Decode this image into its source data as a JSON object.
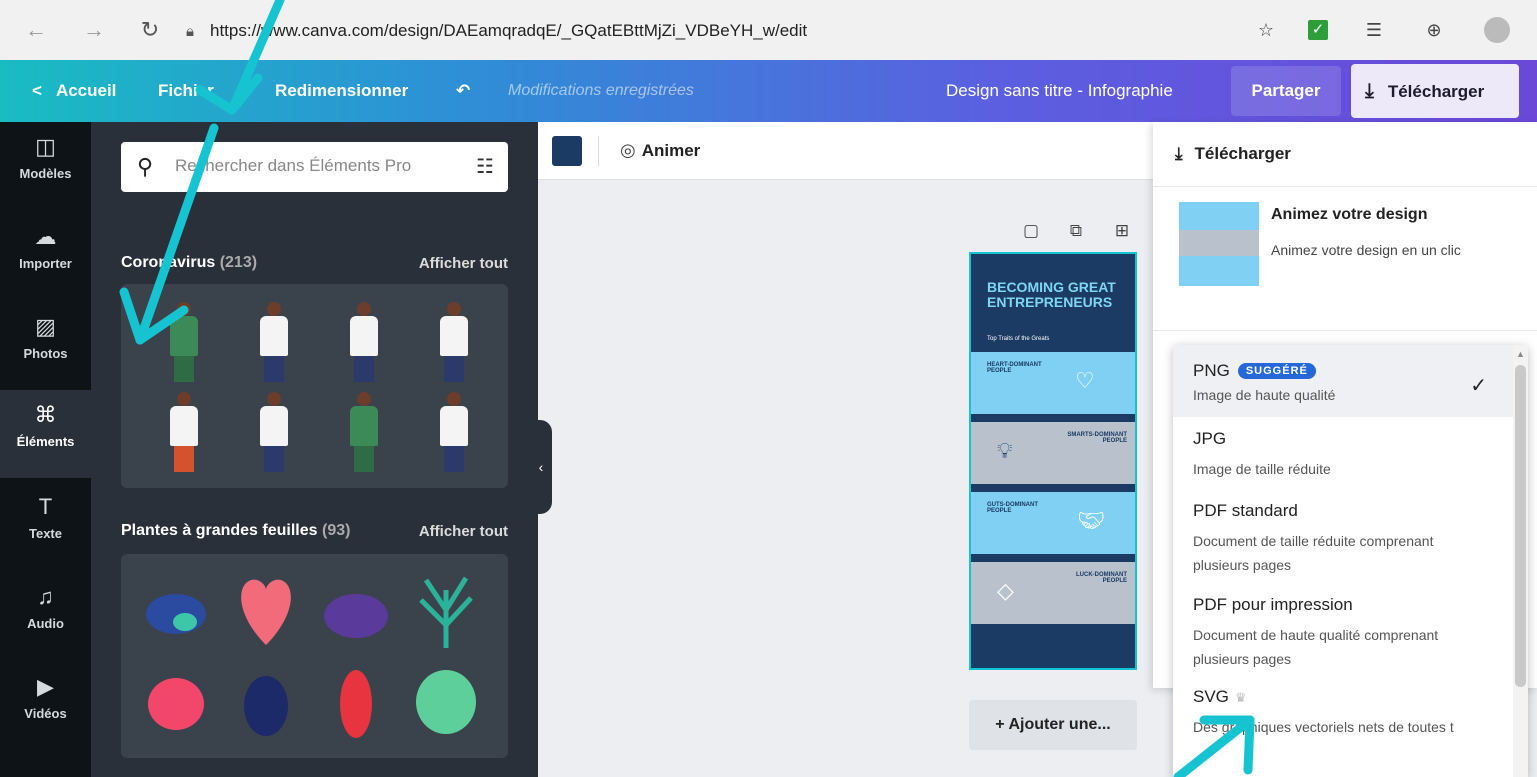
{
  "browser": {
    "url": "https://www.canva.com/design/DAEamqradqE/_GQatEBttMjZi_VDBeYH_w/edit",
    "icons": [
      "back-icon",
      "forward-icon",
      "reload-icon",
      "lock-icon",
      "read-aloud-icon",
      "extension-icon",
      "favorites-icon",
      "collections-icon",
      "profile-icon"
    ]
  },
  "topbar": {
    "home_label": "Accueil",
    "file_label": "Fichier",
    "resize_label": "Redimensionner",
    "saved_status": "Modifications enregistrées",
    "design_title": "Design sans titre - Infographie",
    "share_label": "Partager",
    "download_label": "Télécharger"
  },
  "sidebar": {
    "items": [
      {
        "label": "Modèles",
        "icon": "layout-icon",
        "glyph": "◫"
      },
      {
        "label": "Importer",
        "icon": "cloud-upload-icon",
        "glyph": "☁"
      },
      {
        "label": "Photos",
        "icon": "image-icon",
        "glyph": "▨"
      },
      {
        "label": "Éléments",
        "icon": "shapes-icon",
        "glyph": "⌘"
      },
      {
        "label": "Texte",
        "icon": "text-icon",
        "glyph": "T"
      },
      {
        "label": "Audio",
        "icon": "music-icon",
        "glyph": "♫"
      },
      {
        "label": "Vidéos",
        "icon": "video-icon",
        "glyph": "▶"
      }
    ],
    "active": "Éléments"
  },
  "panel": {
    "search_placeholder": "Rechercher dans Éléments Pro",
    "sections": [
      {
        "title": "Coronavirus",
        "count": "(213)",
        "link": "Afficher tout"
      },
      {
        "title": "Plantes à grandes feuilles",
        "count": "(93)",
        "link": "Afficher tout"
      }
    ]
  },
  "canvas": {
    "color_swatch": "#1b3a64",
    "animate_label": "Animer",
    "add_page_label": "+ Ajouter une...",
    "infographic": {
      "title": "BECOMING GREAT ENTREPRENEURS",
      "subtitle": "Top Traits of the Greats",
      "bands": [
        "HEART-DOMINANT PEOPLE",
        "SMARTS-DOMINANT PEOPLE",
        "GUTS-DOMINANT PEOPLE",
        "LUCK-DOMINANT PEOPLE"
      ]
    }
  },
  "download_panel": {
    "header": "Télécharger",
    "animate_title": "Animez votre design",
    "animate_desc": "Animez votre design en un clic",
    "file_type_options": [
      {
        "name": "PNG",
        "badge": "SUGGÉRÉ",
        "desc": "Image de haute qualité",
        "selected": true
      },
      {
        "name": "JPG",
        "desc": "Image de taille réduite"
      },
      {
        "name": "PDF standard",
        "desc": "Document de taille réduite comprenant plusieurs pages"
      },
      {
        "name": "PDF pour impression",
        "desc": "Document de haute qualité comprenant plusieurs pages"
      },
      {
        "name": "SVG",
        "desc": "Des graphiques vectoriels nets de toutes t",
        "premium": true
      }
    ]
  },
  "colors": {
    "annotation_arrow": "#16c4d1",
    "background": "#1b3a64",
    "accent": "#6b48d8",
    "badge": "#2668d8"
  }
}
